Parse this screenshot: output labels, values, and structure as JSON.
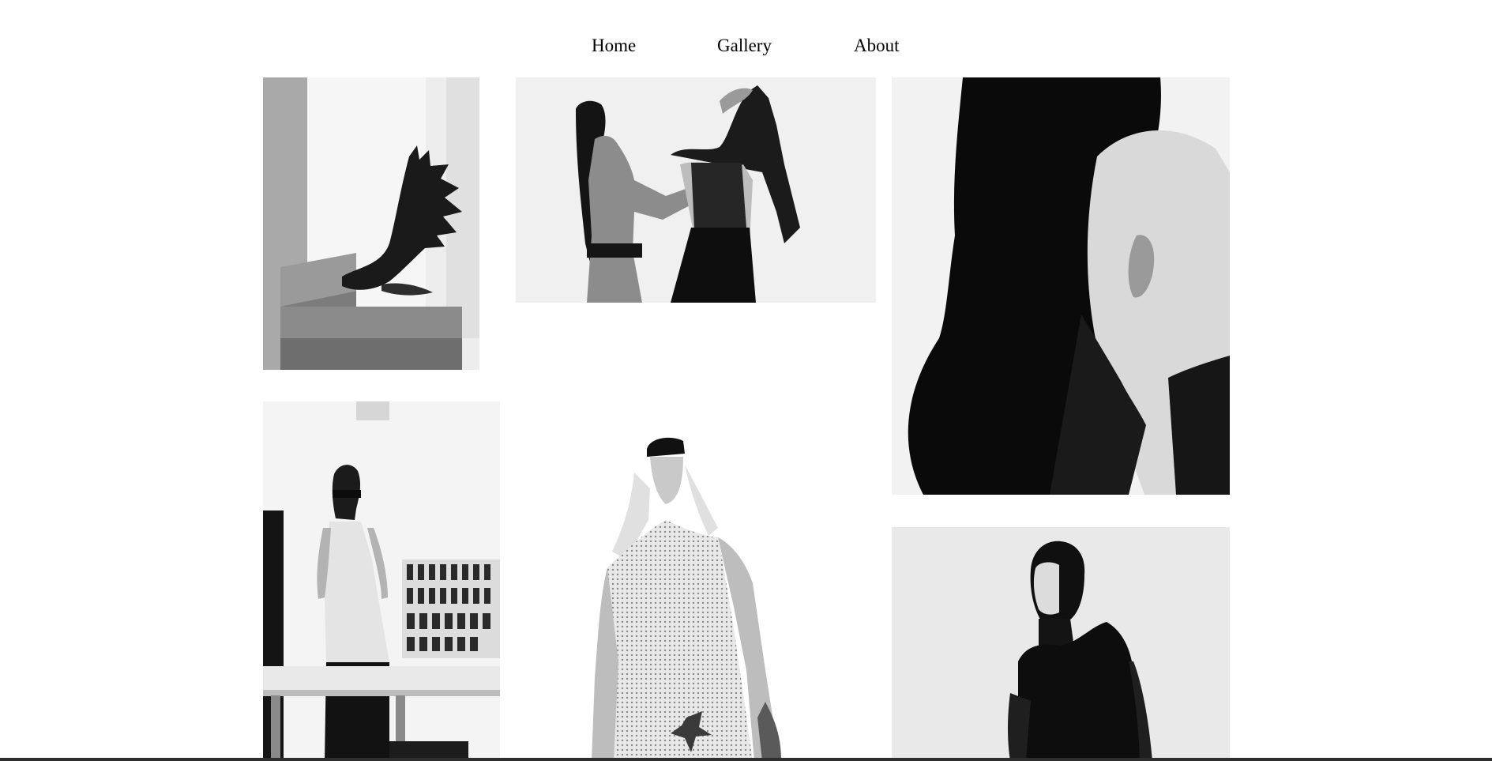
{
  "nav": {
    "home_label": "Home",
    "gallery_label": "Gallery",
    "about_label": "About"
  },
  "colors": {
    "background": "#ffffff",
    "text": "#000000",
    "photo_dark": "#0b0b0b",
    "photo_light": "#efefef"
  },
  "gallery": {
    "images": [
      {
        "subject": "sculpture-antler-chair"
      },
      {
        "subject": "two-models-fitting"
      },
      {
        "subject": "hooded-bald-profile"
      },
      {
        "subject": "studio-model-white-tank"
      },
      {
        "subject": "model-mesh-top-low-angle"
      },
      {
        "subject": "balaclava-model-black-hoodie"
      }
    ]
  }
}
